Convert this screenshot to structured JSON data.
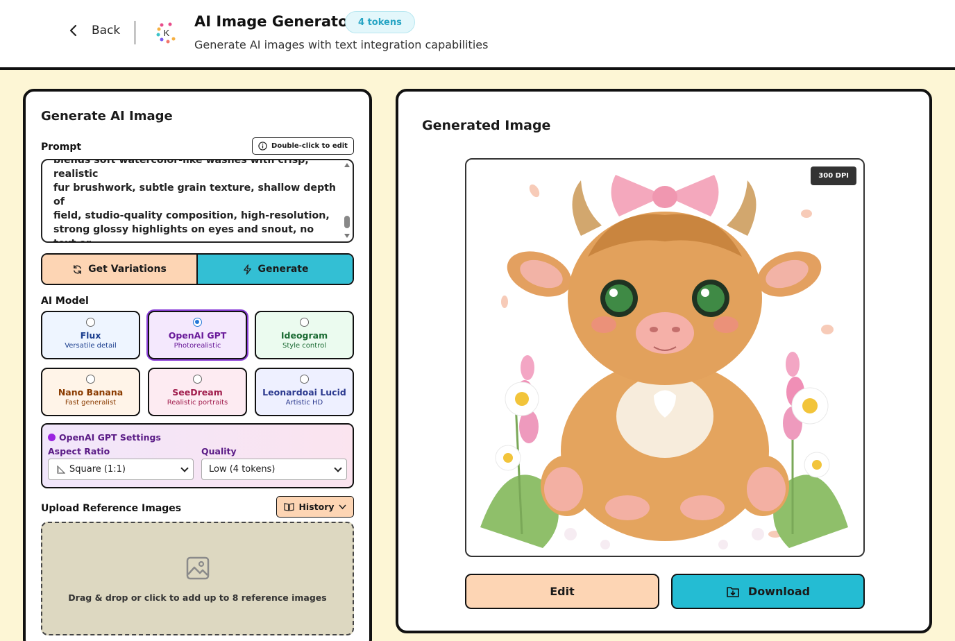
{
  "header": {
    "back_label": "Back",
    "logo_letter": "K",
    "title": "AI Image Generator",
    "tokens_badge": "4 tokens",
    "subtitle": "Generate AI images with text integration capabilities"
  },
  "generator": {
    "title": "Generate AI Image",
    "prompt_label": "Prompt",
    "double_click_hint": "Double-click to edit",
    "prompt_text": "blends soft watercolor-like washes with crisp, realistic\nfur brushwork, subtle grain texture, shallow depth of\nfield, studio-quality composition, high-resolution,\nstrong glossy highlights on eyes and snout, no text or\nlogos.",
    "get_variations_label": "Get Variations",
    "generate_label": "Generate",
    "ai_model_label": "AI Model",
    "models": [
      {
        "name": "Flux",
        "desc": "Versatile detail",
        "selected": false,
        "bg": "#eef5ff",
        "color": "#1c3f8f"
      },
      {
        "name": "OpenAI GPT",
        "desc": "Photorealistic",
        "selected": true,
        "bg": "#f4e8fd",
        "color": "#6a1b9a"
      },
      {
        "name": "Ideogram",
        "desc": "Style control",
        "selected": false,
        "bg": "#ebfbef",
        "color": "#1b6b33"
      },
      {
        "name": "Nano Banana",
        "desc": "Fast generalist",
        "selected": false,
        "bg": "#fff4e8",
        "color": "#8a3b00"
      },
      {
        "name": "SeeDream",
        "desc": "Realistic portraits",
        "selected": false,
        "bg": "#fdebf2",
        "color": "#a01c4c"
      },
      {
        "name": "Leonardoai Lucid",
        "desc": "Artistic HD",
        "selected": false,
        "bg": "#eef0ff",
        "color": "#2c3a8f"
      }
    ],
    "settings": {
      "title": "OpenAI GPT Settings",
      "aspect_label": "Aspect Ratio",
      "aspect_value": "Square (1:1)",
      "quality_label": "Quality",
      "quality_value": "Low (4 tokens)"
    },
    "upload_label": "Upload Reference Images",
    "history_label": "History",
    "dropzone_text": "Drag & drop or click to add up to 8 reference images"
  },
  "result": {
    "title": "Generated Image",
    "dpi_badge": "300 DPI",
    "edit_label": "Edit",
    "download_label": "Download"
  }
}
